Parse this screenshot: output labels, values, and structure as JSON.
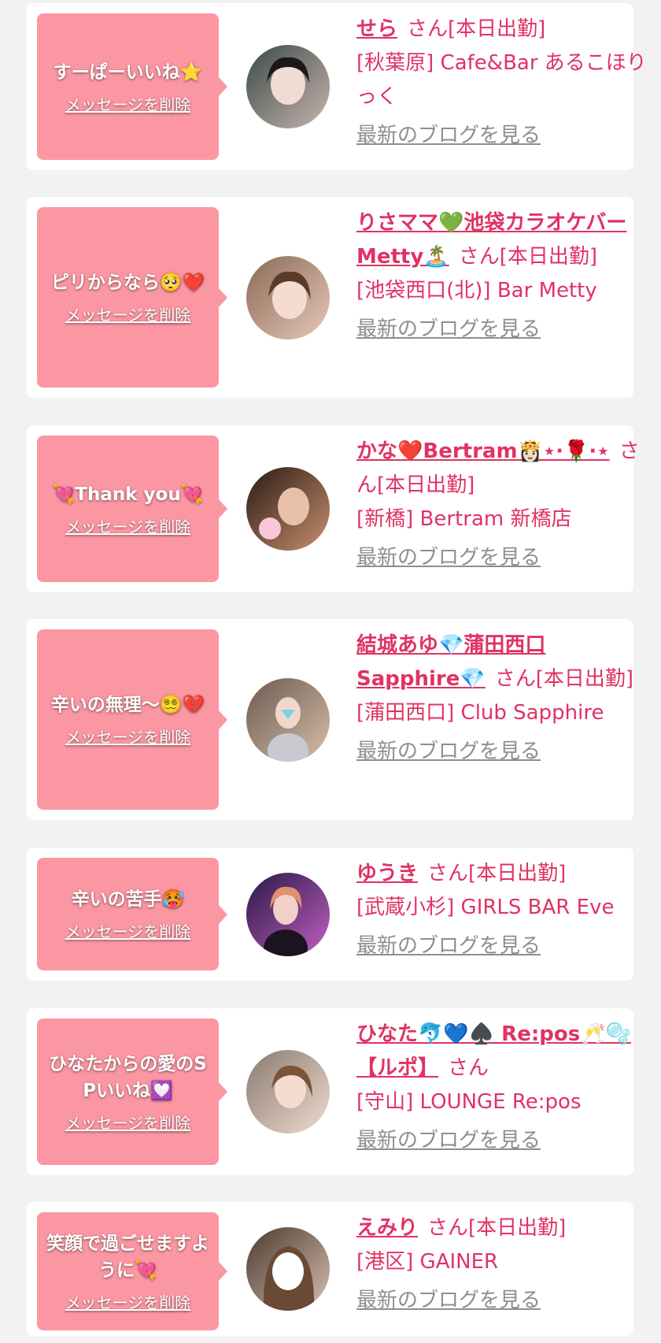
{
  "colors": {
    "bubble": "#fb97a3",
    "accent": "#e03264",
    "muted": "#8e8e8e",
    "card": "#ffffff",
    "background": "#f2f2f2"
  },
  "delete_label": "メッセージを削除",
  "blog_label": "最新のブログを見る",
  "items": [
    {
      "message": "すーぱーいいね⭐",
      "name": "せら",
      "status": "さん[本日出勤]",
      "shop": "[秋葉原] Cafe&Bar あるこほりっく",
      "avatar_colors": [
        "#3a4a48",
        "#c9b5b0"
      ]
    },
    {
      "message": "ピリからなら🥺❤️",
      "name": "りさママ💚池袋カラオケバーMetty🏝️",
      "status": "さん[本日出勤]",
      "shop": "[池袋西口(北)] Bar Metty",
      "avatar_colors": [
        "#8a6a55",
        "#e8c8b8"
      ]
    },
    {
      "message": "💘Thank you💘",
      "name": "かな❤️Bertram👸🏻⋆·🌹·⋆",
      "status": "さん[本日出勤]",
      "shop": "[新橋] Bertram 新橋店",
      "avatar_colors": [
        "#2a1a14",
        "#c89070"
      ]
    },
    {
      "message": "辛いの無理〜😵‍💫💔",
      "name": "結城あゆ💎蒲田西口Sapphire💎",
      "status": "さん[本日出勤]",
      "shop": "[蒲田西口] Club Sapphire",
      "avatar_colors": [
        "#6a5a50",
        "#d8c0a8"
      ]
    },
    {
      "message": "辛いの苦手🥵",
      "name": "ゆうき",
      "status": "さん[本日出勤]",
      "shop": "[武蔵小杉] GIRLS BAR Eve",
      "avatar_colors": [
        "#2a1846",
        "#c060c0"
      ]
    },
    {
      "message": "ひなたからの愛のSPいいね💟",
      "name": "ひなた🐬💙♠️ Re:pos🥂🫧【ルポ】",
      "status": "さん",
      "shop": "[守山] LOUNGE Re:pos",
      "avatar_colors": [
        "#8a7a70",
        "#f0dcd0"
      ]
    },
    {
      "message": "笑顔で過ごせますように💘",
      "name": "えみり",
      "status": "さん[本日出勤]",
      "shop": "[港区] GAINER",
      "avatar_colors": [
        "#4a3a30",
        "#d8c0b0"
      ]
    }
  ]
}
